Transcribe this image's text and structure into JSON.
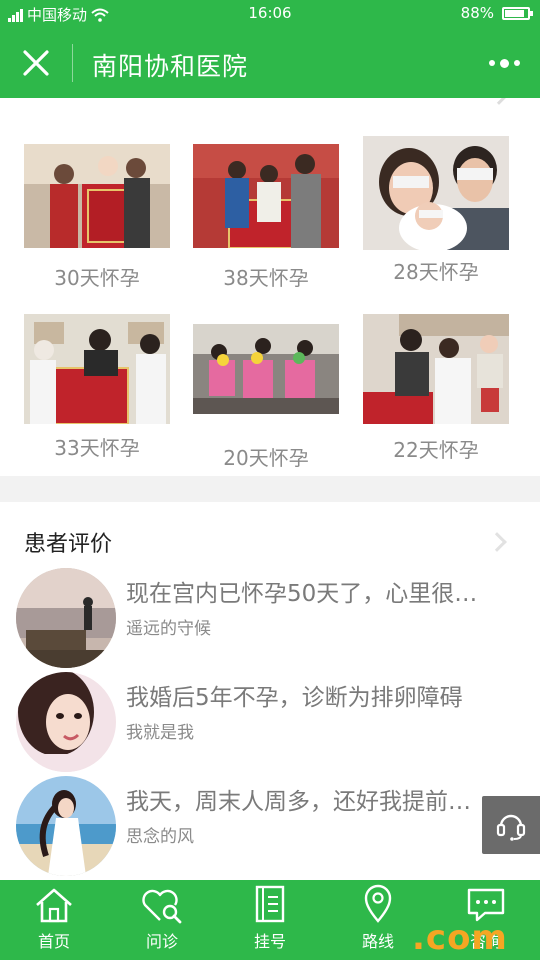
{
  "status_bar": {
    "carrier": "中国移动",
    "time": "16:06",
    "battery": "88%",
    "battery_level": 0.88
  },
  "header": {
    "title": "南阳协和医院",
    "close_icon": "close-icon",
    "more_icon": "more-dots-icon"
  },
  "cases": {
    "items": [
      {
        "label": "30天怀孕"
      },
      {
        "label": "38天怀孕"
      },
      {
        "label": "28天怀孕"
      },
      {
        "label": "33天怀孕"
      },
      {
        "label": "20天怀孕"
      },
      {
        "label": "22天怀孕"
      }
    ]
  },
  "reviews": {
    "title": "患者评价",
    "items": [
      {
        "text": "现在宫内已怀孕50天了，心里很…",
        "user": "遥远的守候"
      },
      {
        "text": "我婚后5年不孕，诊断为排卵障碍",
        "user": "我就是我"
      },
      {
        "text": "我天，周末人周多，还好我提前…",
        "user": "思念的风"
      }
    ]
  },
  "tabbar": {
    "items": [
      {
        "label": "首页",
        "icon": "home-icon"
      },
      {
        "label": "问诊",
        "icon": "consult-heart-icon"
      },
      {
        "label": "挂号",
        "icon": "register-book-icon"
      },
      {
        "label": "路线",
        "icon": "location-pin-icon"
      },
      {
        "label": "咨询",
        "icon": "chat-bubble-icon"
      }
    ]
  },
  "watermark": {
    "text": ".com"
  },
  "colors": {
    "brand_green": "#2eb84a",
    "text_gray": "#8a8a8a",
    "float_button": "#6b6b6b"
  }
}
